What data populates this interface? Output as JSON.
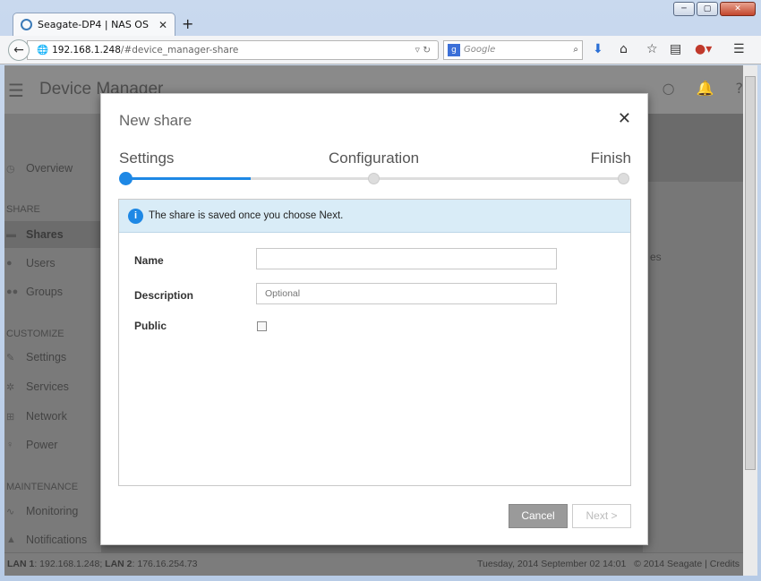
{
  "browser": {
    "tab_title": "Seagate-DP4 | NAS OS",
    "tab_close": "✕",
    "new_tab": "+",
    "url_host": "192.168.1.248",
    "url_path": "/#device_manager-share",
    "search_placeholder": "Google",
    "window_controls": [
      "─",
      "▢",
      "✕"
    ]
  },
  "app": {
    "title": "Device Manager",
    "sidebar": {
      "overview": "Overview",
      "section_share": "SHARE",
      "shares": "Shares",
      "users": "Users",
      "groups": "Groups",
      "section_customize": "CUSTOMIZE",
      "settings": "Settings",
      "services": "Services",
      "network": "Network",
      "power": "Power",
      "section_maintenance": "MAINTENANCE",
      "monitoring": "Monitoring",
      "notifications": "Notifications"
    },
    "right_fragment": "es",
    "footer": {
      "lan1_label": "LAN 1",
      "lan1_value": ": 192.168.1.248; ",
      "lan2_label": "LAN 2",
      "lan2_value": ": 176.16.254.73",
      "datetime": "Tuesday, 2014 September 02   14:01",
      "copyright": "© 2014 Seagate | Credits"
    }
  },
  "modal": {
    "title": "New share",
    "steps": [
      "Settings",
      "Configuration",
      "Finish"
    ],
    "progress_fraction": 0.25,
    "info_text": "The share is saved once you choose Next.",
    "name_label": "Name",
    "name_value": "",
    "description_label": "Description",
    "description_placeholder": "Optional",
    "public_label": "Public",
    "public_checked": false,
    "cancel_label": "Cancel",
    "next_label": "Next >"
  }
}
